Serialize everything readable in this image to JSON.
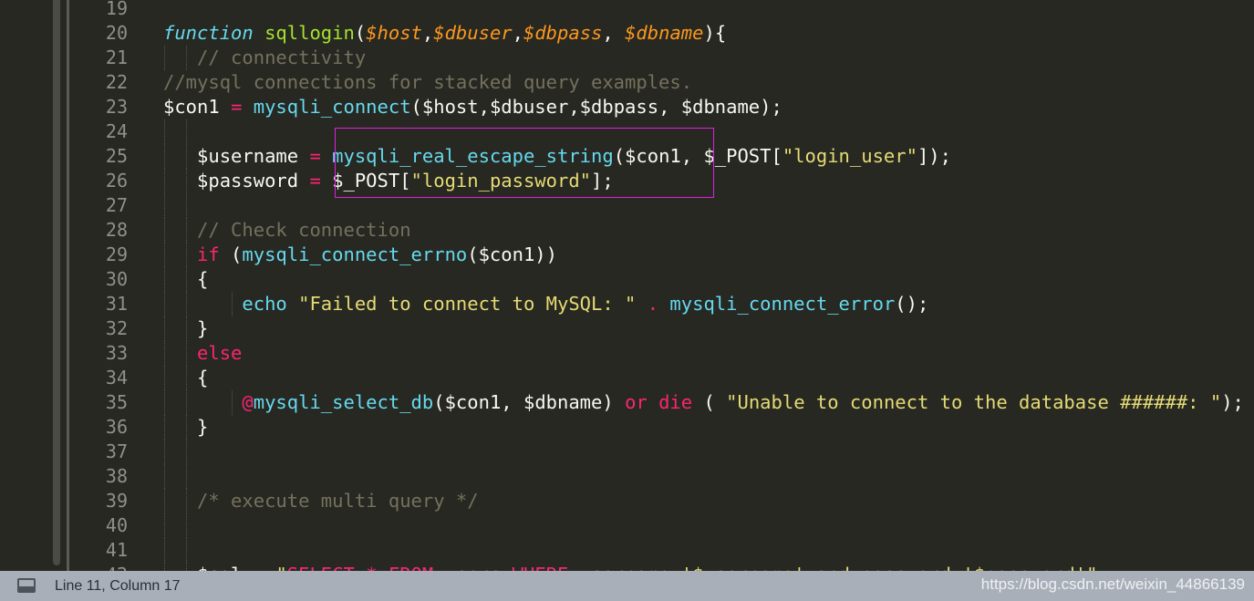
{
  "editor": {
    "lines": [
      {
        "n": "19",
        "tokens": []
      },
      {
        "n": "20",
        "tokens": [
          [
            "kw",
            "function"
          ],
          [
            "plain",
            " "
          ],
          [
            "fn",
            "sqllogin"
          ],
          [
            "plain",
            "("
          ],
          [
            "param",
            "$host"
          ],
          [
            "plain",
            ","
          ],
          [
            "param",
            "$dbuser"
          ],
          [
            "plain",
            ","
          ],
          [
            "param",
            "$dbpass"
          ],
          [
            "plain",
            ", "
          ],
          [
            "param",
            "$dbname"
          ],
          [
            "plain",
            "){"
          ]
        ]
      },
      {
        "n": "21",
        "tokens": [
          [
            "plain",
            "   "
          ],
          [
            "cm",
            "// connectivity"
          ]
        ]
      },
      {
        "n": "22",
        "tokens": [
          [
            "cm",
            "//mysql connections for stacked query examples."
          ]
        ]
      },
      {
        "n": "23",
        "tokens": [
          [
            "plain",
            "$con1 "
          ],
          [
            "op",
            "="
          ],
          [
            "plain",
            " "
          ],
          [
            "call",
            "mysqli_connect"
          ],
          [
            "plain",
            "($host,$dbuser,$dbpass, $dbname);"
          ]
        ]
      },
      {
        "n": "24",
        "tokens": []
      },
      {
        "n": "25",
        "tokens": [
          [
            "plain",
            "   $username "
          ],
          [
            "op",
            "="
          ],
          [
            "plain",
            " "
          ],
          [
            "call",
            "mysqli_real_escape_string"
          ],
          [
            "plain",
            "($con1, $_POST["
          ],
          [
            "str",
            "\"login_user\""
          ],
          [
            "plain",
            "]);"
          ]
        ]
      },
      {
        "n": "26",
        "tokens": [
          [
            "plain",
            "   $password "
          ],
          [
            "op",
            "="
          ],
          [
            "plain",
            " $_POST["
          ],
          [
            "str",
            "\"login_password\""
          ],
          [
            "plain",
            "];"
          ]
        ]
      },
      {
        "n": "27",
        "tokens": []
      },
      {
        "n": "28",
        "tokens": [
          [
            "plain",
            "   "
          ],
          [
            "cm",
            "// Check connection"
          ]
        ]
      },
      {
        "n": "29",
        "tokens": [
          [
            "plain",
            "   "
          ],
          [
            "op",
            "if"
          ],
          [
            "plain",
            " ("
          ],
          [
            "call",
            "mysqli_connect_errno"
          ],
          [
            "plain",
            "($con1))"
          ]
        ]
      },
      {
        "n": "30",
        "tokens": [
          [
            "plain",
            "   {"
          ]
        ]
      },
      {
        "n": "31",
        "tokens": [
          [
            "plain",
            "       "
          ],
          [
            "call",
            "echo"
          ],
          [
            "plain",
            " "
          ],
          [
            "str",
            "\"Failed to connect to MySQL: \""
          ],
          [
            "plain",
            " "
          ],
          [
            "op",
            "."
          ],
          [
            "plain",
            " "
          ],
          [
            "call",
            "mysqli_connect_error"
          ],
          [
            "plain",
            "();"
          ]
        ]
      },
      {
        "n": "32",
        "tokens": [
          [
            "plain",
            "   }"
          ]
        ]
      },
      {
        "n": "33",
        "tokens": [
          [
            "plain",
            "   "
          ],
          [
            "op",
            "else"
          ]
        ]
      },
      {
        "n": "34",
        "tokens": [
          [
            "plain",
            "   {"
          ]
        ]
      },
      {
        "n": "35",
        "tokens": [
          [
            "plain",
            "       "
          ],
          [
            "op",
            "@"
          ],
          [
            "call",
            "mysqli_select_db"
          ],
          [
            "plain",
            "($con1, $dbname) "
          ],
          [
            "op",
            "or"
          ],
          [
            "plain",
            " "
          ],
          [
            "op",
            "die"
          ],
          [
            "plain",
            " ( "
          ],
          [
            "str",
            "\"Unable to connect to the database ######: \""
          ],
          [
            "plain",
            ");"
          ]
        ]
      },
      {
        "n": "36",
        "tokens": [
          [
            "plain",
            "   }"
          ]
        ]
      },
      {
        "n": "37",
        "tokens": []
      },
      {
        "n": "38",
        "tokens": []
      },
      {
        "n": "39",
        "tokens": [
          [
            "plain",
            "   "
          ],
          [
            "cm",
            "/* execute multi query */"
          ]
        ]
      },
      {
        "n": "40",
        "tokens": []
      },
      {
        "n": "41",
        "tokens": []
      },
      {
        "n": "42",
        "tokens": [
          [
            "plain",
            "   $sql "
          ],
          [
            "op",
            "="
          ],
          [
            "plain",
            " "
          ],
          [
            "str",
            "\""
          ],
          [
            "op",
            "SELECT * FROM"
          ],
          [
            "str",
            " users "
          ],
          [
            "op",
            "WHERE"
          ],
          [
            "str",
            " username='$username' and password='$password'\""
          ],
          [
            "plain",
            ";"
          ]
        ]
      }
    ]
  },
  "status_bar": {
    "position": "Line 11, Column 17",
    "watermark": "https://blog.csdn.net/weixin_44866139"
  },
  "colors": {
    "background": "#272822",
    "keyword": "#66d9ef",
    "function_name": "#a6e22e",
    "parameter": "#fd971f",
    "comment": "#75715e",
    "string": "#e6db74",
    "operator": "#f92672",
    "highlight_box": "#e020e0",
    "status_bar": "#a9afb9"
  }
}
